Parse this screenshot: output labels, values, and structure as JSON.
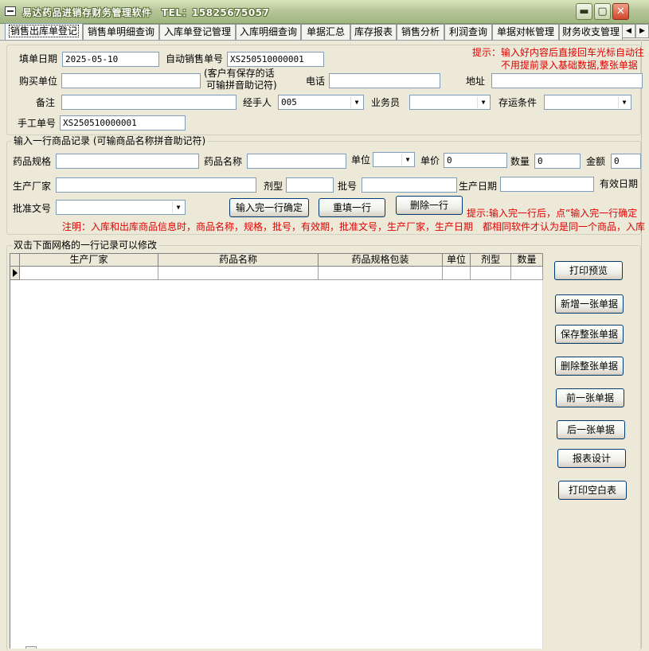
{
  "window": {
    "title": "易达药品进销存财务管理软件　TEL：15825675057",
    "minimize": "▬",
    "restore": "▢",
    "close": "✕"
  },
  "tabs": [
    {
      "label": "销售出库单登记",
      "active": true
    },
    {
      "label": "销售单明细查询"
    },
    {
      "label": "入库单登记管理"
    },
    {
      "label": "入库明细查询"
    },
    {
      "label": "单据汇总"
    },
    {
      "label": "库存报表"
    },
    {
      "label": "销售分析"
    },
    {
      "label": "利润查询"
    },
    {
      "label": "单据对帐管理"
    },
    {
      "label": "财务收支管理"
    }
  ],
  "tab_scroll": {
    "left": "◀",
    "right": "▶"
  },
  "header_form": {
    "fill_date_label": "填单日期",
    "fill_date_value": "2025-05-10",
    "auto_no_label": "自动销售单号",
    "auto_no_value": "XS250510000001",
    "hint_line1": "提示：输入好内容后直接回车光标自动往",
    "hint_line2": "不用提前录入基础数据,整张单据",
    "buyer_label": "购买单位",
    "buyer_value": "",
    "buyer_note_line1": "(客户有保存的话",
    "buyer_note_line2": "可输拼音助记符)",
    "phone_label": "电话",
    "phone_value": "",
    "address_label": "地址",
    "address_value": "",
    "remark_label": "备注",
    "remark_value": "",
    "handler_label": "经手人",
    "handler_value": "005",
    "salesman_label": "业务员",
    "salesman_value": "",
    "storage_label": "存运条件",
    "storage_value": "",
    "manual_no_label": "手工单号",
    "manual_no_value": "XS250510000001"
  },
  "item_form": {
    "group_title": "输入一行商品记录 (可输商品名称拼音助记符)",
    "spec_label": "药品规格",
    "spec_value": "",
    "name_label": "药品名称",
    "name_value": "",
    "unit_label": "单位",
    "unit_value": "",
    "price_label": "单价",
    "price_value": "0",
    "qty_label": "数量",
    "qty_value": "0",
    "amount_label": "金额",
    "amount_value": "0",
    "maker_label": "生产厂家",
    "maker_value": "",
    "dosage_label": "剂型",
    "dosage_value": "",
    "batch_label": "批号",
    "batch_value": "",
    "mfg_date_label": "生产日期",
    "mfg_date_value": "",
    "expiry_label": "有效日期",
    "approval_label": "批准文号",
    "approval_value": "",
    "confirm_button": "输入完一行确定",
    "refill_button": "重填一行",
    "delete_button": "删除一行",
    "hint_after": "提示:输入完一行后，点“输入完一行确定",
    "note": "注明：入库和出库商品信息时，商品名称，规格，批号，有效期，批准文号，生产厂家，生产日期　都相同软件才认为是同一个商品，入库"
  },
  "grid": {
    "group_title": "双击下面网格的一行记录可以修改",
    "columns": [
      "生产厂家",
      "药品名称",
      "药品规格包装",
      "单位",
      "剂型",
      "数量"
    ]
  },
  "actions": {
    "print_preview": "打印预览",
    "new_doc": "新增一张单据",
    "save_doc": "保存整张单据",
    "delete_doc": "删除整张单据",
    "prev_doc": "前一张单据",
    "next_doc": "后一张单据",
    "report_design": "报表设计",
    "print_blank": "打印空白表"
  },
  "colors": {
    "hint_red": "#e00000",
    "input_border": "#7f9db9",
    "window_bg": "#ece9d8"
  }
}
